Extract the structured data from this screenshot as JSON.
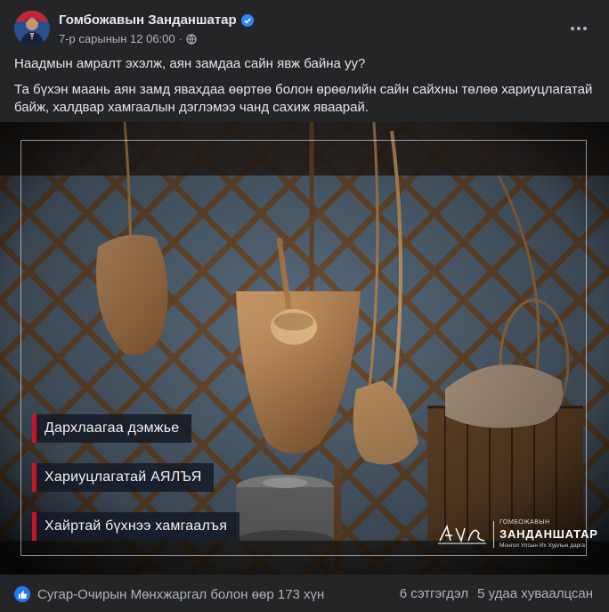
{
  "post": {
    "author": "Гомбожавын Занданшатар",
    "timestamp": "7-р сарынын 12 06:00",
    "audience_icon": "globe-icon",
    "more_icon": "more-horizontal-icon",
    "verified_icon": "verified-badge-icon",
    "text_line1": "Наадмын амралт эхэлж, аян замдаа сайн явж байна уу?",
    "text_line2": "Та бүхэн маань аян замд явахдаа өөртөө болон өрөөлийн сайн сайхны төлөө хариуцлагатай байж, халдвар хамгаалын дэглэмээ чанд сахиж яваарай."
  },
  "image": {
    "banners": [
      "Дархлаагаа дэмжье",
      "Хариуцлагатай АЯЛЪЯ",
      "Хайртай бүхнээ хамгаалъя"
    ],
    "brand_top": "ГОМБОЖАВЫН",
    "brand_name": "ЗАНДАНШАТАР",
    "brand_sub": "Монгол Улсын Их Хурлын дарга",
    "accent_color": "#c4152b"
  },
  "footer": {
    "reaction_icon": "like-icon",
    "reactions_text": "Сугар-Очирын Мөнхжаргал болон өөр 173 хүн",
    "comments_text": "6 сэтгэгдэл",
    "shares_text": "5 удаа хуваалцсан"
  }
}
